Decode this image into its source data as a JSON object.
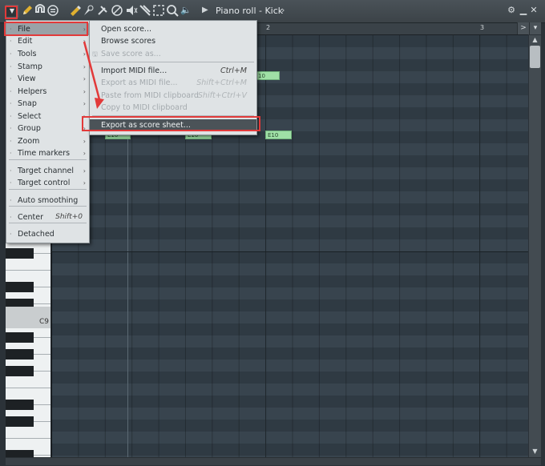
{
  "window": {
    "title": "Piano roll - Kick"
  },
  "toolbar": {
    "icons": [
      "menu-arrow-icon",
      "pencil-icon",
      "magnet-icon",
      "snap-icon",
      "paint-icon",
      "brush-icon",
      "delete-icon",
      "mute-icon",
      "slice-icon",
      "select-icon",
      "zoom-icon",
      "speaker-icon",
      "arrow-right-icon"
    ],
    "menu_glyph": "▼",
    "speaker_glyph": "🔈",
    "arrow_glyph": "▶",
    "chevron_glyph": "›"
  },
  "window_controls": {
    "options": "⚙",
    "minimize": "▁",
    "maximize": "□",
    "close": "✕"
  },
  "ruler": {
    "marks": [
      "2",
      "3"
    ],
    "arrow": ">",
    "dropdown": "▾"
  },
  "keyboard": {
    "label": "C9"
  },
  "notes": [
    {
      "label": "10"
    },
    {
      "label": "E10"
    },
    {
      "label": "E10"
    },
    {
      "label": "E10"
    }
  ],
  "main_menu": {
    "items": [
      {
        "label": "File",
        "has_submenu": true,
        "selected": true
      },
      {
        "label": "Edit",
        "has_submenu": true
      },
      {
        "label": "Tools",
        "has_submenu": true
      },
      {
        "label": "Stamp",
        "has_submenu": true
      },
      {
        "label": "View",
        "has_submenu": true
      },
      {
        "label": "Helpers",
        "has_submenu": true
      },
      {
        "label": "Snap",
        "has_submenu": true
      },
      {
        "label": "Select",
        "has_submenu": true
      },
      {
        "label": "Group",
        "has_submenu": true
      },
      {
        "label": "Zoom",
        "has_submenu": true
      },
      {
        "label": "Time markers",
        "has_submenu": true
      },
      {
        "label": "Target channel",
        "has_submenu": true
      },
      {
        "label": "Target control",
        "has_submenu": true
      },
      {
        "label": "Auto smoothing"
      },
      {
        "label": "Center",
        "shortcut": "Shift+0"
      },
      {
        "label": "Detached"
      }
    ]
  },
  "file_menu": {
    "items": [
      {
        "label": "Open score...",
        "enabled": true
      },
      {
        "label": "Browse scores",
        "enabled": true
      },
      {
        "label": "Save score as...",
        "enabled": false
      },
      {
        "label": "Import MIDI file...",
        "shortcut": "Ctrl+M",
        "enabled": true
      },
      {
        "label": "Export as MIDI file...",
        "shortcut": "Shift+Ctrl+M",
        "enabled": false
      },
      {
        "label": "Paste from MIDI clipboard",
        "shortcut": "Shift+Ctrl+V",
        "enabled": false
      },
      {
        "label": "Copy to MIDI clipboard",
        "enabled": false
      },
      {
        "label": "Export as score sheet...",
        "enabled": true,
        "selected": true
      }
    ]
  },
  "colors": {
    "annotation": "#e23a3a",
    "note": "#9fe0a6",
    "grid": "#34404a"
  }
}
